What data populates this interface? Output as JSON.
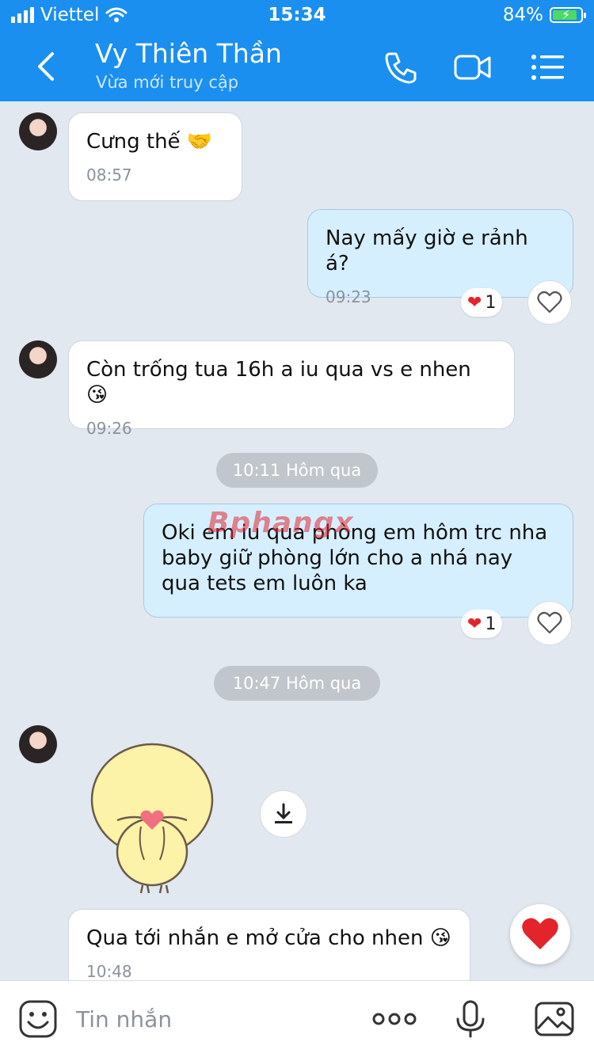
{
  "status_bar": {
    "carrier": "Viettel",
    "time": "15:34",
    "battery": "84%"
  },
  "header": {
    "name": "Vy Thiên Thần",
    "status": "Vừa mới truy cập"
  },
  "watermark": "Bphangx",
  "messages": [
    {
      "text": "Cưng thế 🤝",
      "time": "08:57"
    },
    {
      "text": "Nay mấy giờ e rảnh á?",
      "time": "09:23",
      "reaction_count": "1"
    },
    {
      "text": "Còn trống tua 16h a iu qua vs e nhen 😘",
      "time": "09:26"
    },
    {
      "text": "Oki em iu qua phòng em hôm trc nha baby giữ phòng lớn cho a nhá nay qua tets em luôn ka",
      "reaction_count": "1"
    },
    {
      "text": "Qua tới nhắn e mở cửa cho nhen 😘",
      "time": "10:48"
    }
  ],
  "separators": [
    "10:11 Hôm qua",
    "10:47 Hôm qua"
  ],
  "input": {
    "placeholder": "Tin nhắn"
  },
  "colors": {
    "header": "#1a8ff0",
    "outgoing_bubble": "#d6efff",
    "background": "#e2e8f0"
  }
}
